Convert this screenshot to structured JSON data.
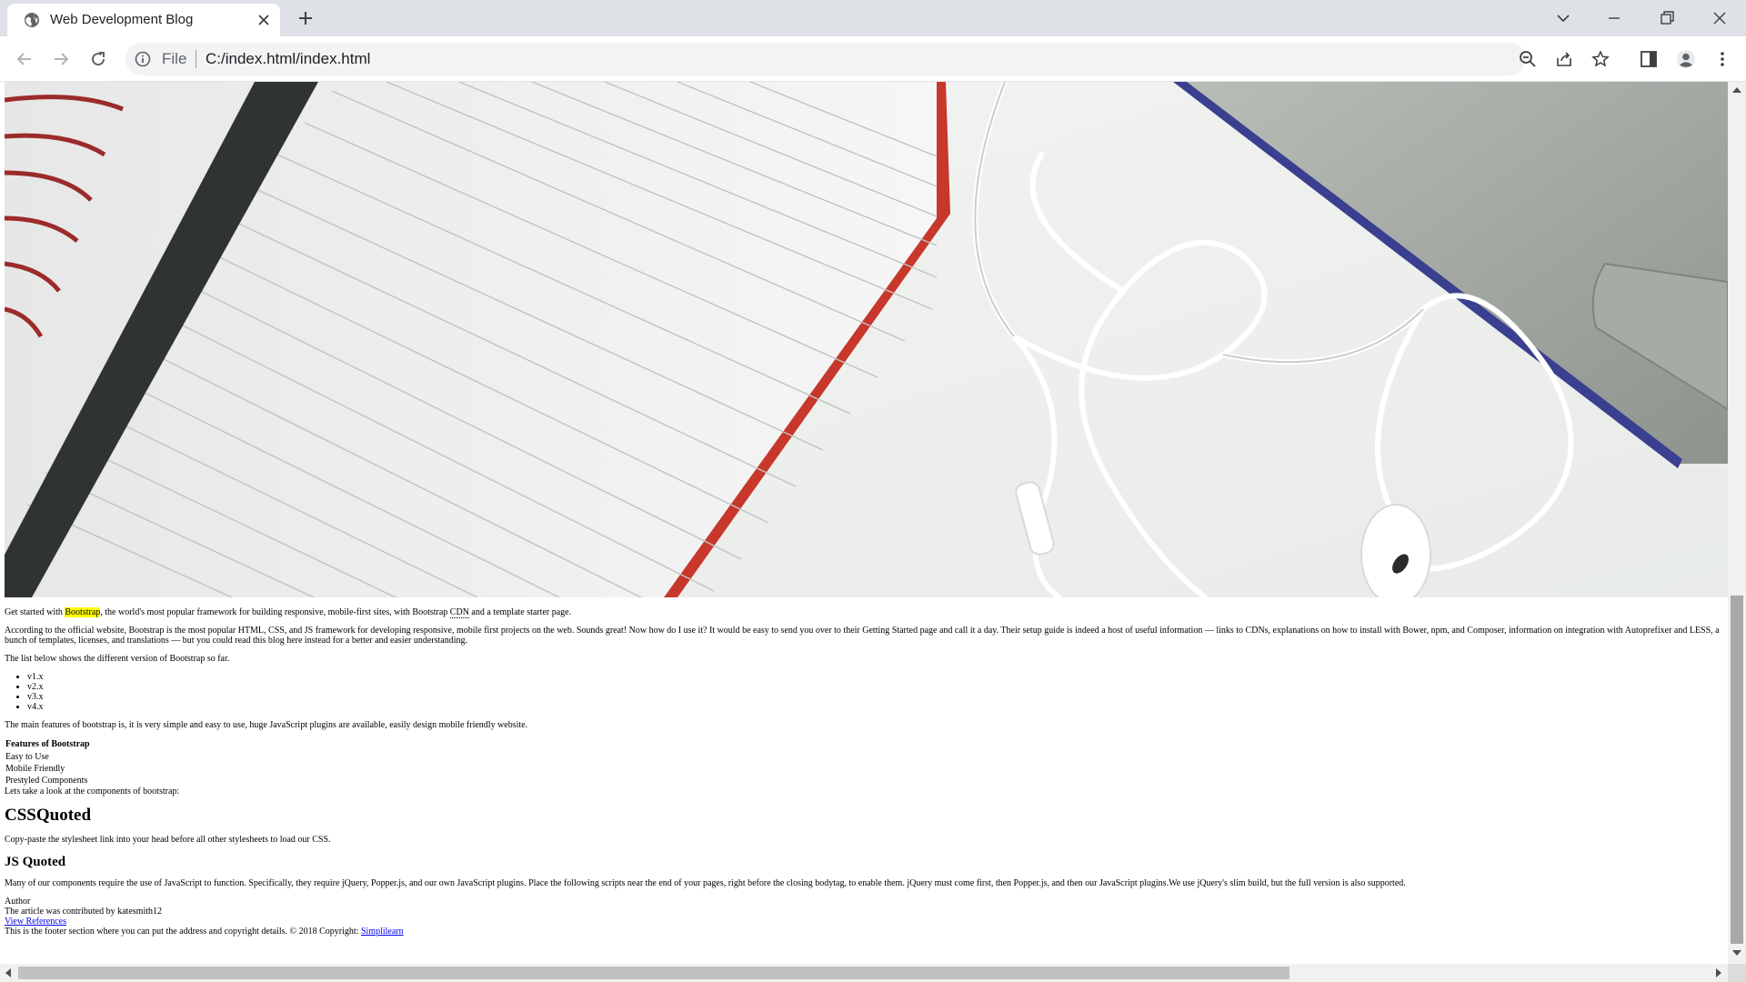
{
  "browser": {
    "tab_title": "Web Development Blog",
    "url_scheme_label": "File",
    "url": "C:/index.html/index.html"
  },
  "icons": {
    "favicon": "globe-icon",
    "tab_close": "close-icon",
    "new_tab": "plus-icon",
    "tab_search": "chevron-down-icon",
    "minimize": "minimize-icon",
    "restore": "restore-icon",
    "close_window": "close-icon",
    "back": "back-arrow-icon",
    "forward": "forward-arrow-icon",
    "reload": "reload-icon",
    "site_info": "info-icon",
    "zoom": "zoom-out-icon",
    "share": "share-icon",
    "bookmark": "star-icon",
    "side_panel": "side-panel-icon",
    "profile": "profile-icon",
    "menu": "kebab-menu-icon"
  },
  "article": {
    "intro": {
      "before": "Get started with ",
      "highlight": "Bootstrap",
      "middle": ", the world's most popular framework for building responsive, mobile-first sites, with Bootstrap ",
      "abbr": "CDN",
      "after": " and a template starter page."
    },
    "para2": "According to the official website, Bootstrap is the most popular HTML, CSS, and JS framework for developing responsive, mobile first projects on the web. Sounds great! Now how do I use it? It would be easy to send you over to their Getting Started page and call it a day. Their setup guide is indeed a host of useful information — links to CDNs, explanations on how to install with Bower, npm, and Composer, information on integration with Autoprefixer and LESS, a bunch of templates, licenses, and translations — but you could read this blog here instead for a better and easier understanding.",
    "para3": "The list below shows the different version of Bootstrap so far.",
    "versions": [
      "v1.x",
      "v2.x",
      "v3.x",
      "v4.x"
    ],
    "para4": "The main features of bootstrap is, it is very simple and easy to use, huge JavaScript plugins are available, easily design mobile friendly website.",
    "features_header": "Features of Bootstrap",
    "features": [
      "Easy to Use",
      "Mobile Friendly",
      "Prestyled Components"
    ],
    "components_intro": "Lets take a look at the components of bootstrap:",
    "css_heading": "CSSQuoted",
    "css_text": "Copy-paste the stylesheet link into your head before all other stylesheets to load our CSS.",
    "js_heading": "JS Quoted",
    "js_text": "Many of our components require the use of JavaScript to function. Specifically, they require jQuery, Popper.js, and our own JavaScript plugins. Place the following scripts near the end of your pages, right before the closing bodytag, to enable them. jQuery must come first, then Popper.js, and then our JavaScript plugins.We use jQuery's slim build, but the full version is also supported."
  },
  "footer": {
    "author_label": "Author",
    "contribution": "The article was contributed by katesmith12",
    "references_link": "View References",
    "footer_text": "This is the footer section where you can put the address and copyright details. © 2018 Copyright: ",
    "copyright_link": "Simplilearn"
  },
  "colors": {
    "highlight": "#ffff00",
    "link": "#0000ee",
    "tabstrip": "#dee1e6"
  }
}
